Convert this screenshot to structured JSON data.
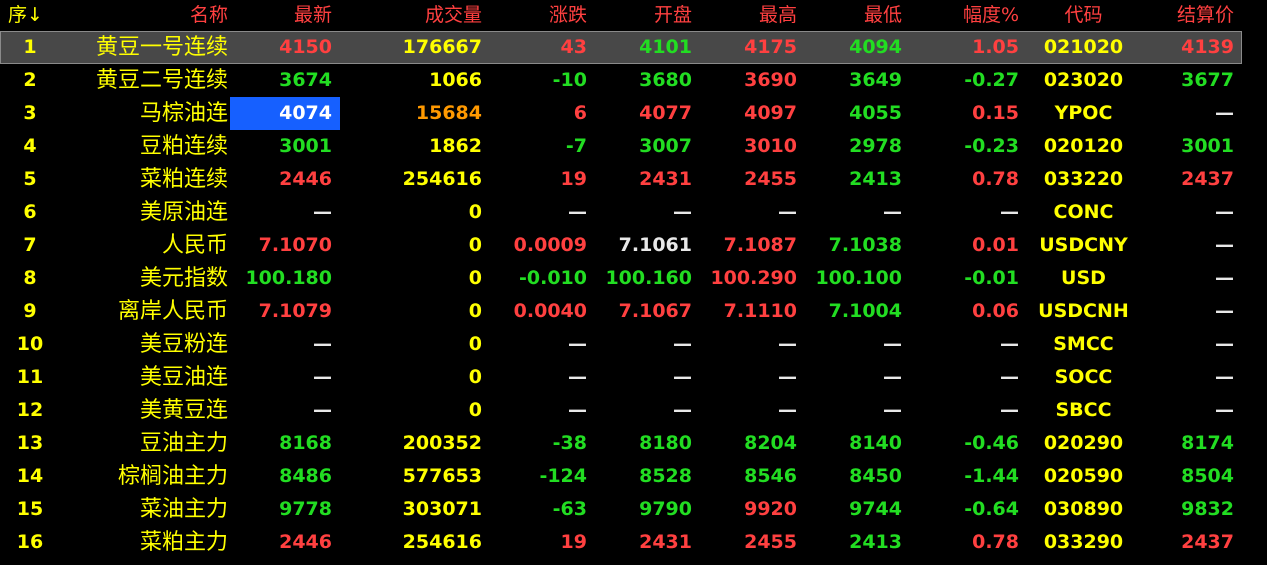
{
  "header": {
    "idx": "序",
    "idx_arrow": "↓",
    "name": "名称",
    "last": "最新",
    "volume": "成交量",
    "change": "涨跌",
    "open": "开盘",
    "high": "最高",
    "low": "最低",
    "pct": "幅度%",
    "code": "代码",
    "settle": "结算价"
  },
  "colors": {
    "up": "#ff4040",
    "down": "#22dd22",
    "header_text": "#ff4040",
    "name_text": "#ffff00",
    "selected_row_bg": "#484848",
    "highlight_cell_bg": "#1660ff"
  },
  "rows": [
    {
      "idx": "1",
      "name": "黄豆一号连续",
      "last": "4150",
      "volume": "176667",
      "change": "43",
      "open": "4101",
      "high": "4175",
      "low": "4094",
      "pct": "1.05",
      "code": "021020",
      "settle": "4139"
    },
    {
      "idx": "2",
      "name": "黄豆二号连续",
      "last": "3674",
      "volume": "1066",
      "change": "-10",
      "open": "3680",
      "high": "3690",
      "low": "3649",
      "pct": "-0.27",
      "code": "023020",
      "settle": "3677"
    },
    {
      "idx": "3",
      "name": "马棕油连",
      "last": "4074",
      "volume": "15684",
      "change": "6",
      "open": "4077",
      "high": "4097",
      "low": "4055",
      "pct": "0.15",
      "code": "YPOC",
      "settle": "—"
    },
    {
      "idx": "4",
      "name": "豆粕连续",
      "last": "3001",
      "volume": "1862",
      "change": "-7",
      "open": "3007",
      "high": "3010",
      "low": "2978",
      "pct": "-0.23",
      "code": "020120",
      "settle": "3001"
    },
    {
      "idx": "5",
      "name": "菜粕连续",
      "last": "2446",
      "volume": "254616",
      "change": "19",
      "open": "2431",
      "high": "2455",
      "low": "2413",
      "pct": "0.78",
      "code": "033220",
      "settle": "2437"
    },
    {
      "idx": "6",
      "name": "美原油连",
      "last": "—",
      "volume": "0",
      "change": "—",
      "open": "—",
      "high": "—",
      "low": "—",
      "pct": "—",
      "code": "CONC",
      "settle": "—"
    },
    {
      "idx": "7",
      "name": "人民币",
      "last": "7.1070",
      "volume": "0",
      "change": "0.0009",
      "open": "7.1061",
      "high": "7.1087",
      "low": "7.1038",
      "pct": "0.01",
      "code": "USDCNY",
      "settle": "—"
    },
    {
      "idx": "8",
      "name": "美元指数",
      "last": "100.180",
      "volume": "0",
      "change": "-0.010",
      "open": "100.160",
      "high": "100.290",
      "low": "100.100",
      "pct": "-0.01",
      "code": "USD",
      "settle": "—"
    },
    {
      "idx": "9",
      "name": "离岸人民币",
      "last": "7.1079",
      "volume": "0",
      "change": "0.0040",
      "open": "7.1067",
      "high": "7.1110",
      "low": "7.1004",
      "pct": "0.06",
      "code": "USDCNH",
      "settle": "—"
    },
    {
      "idx": "10",
      "name": "美豆粉连",
      "last": "—",
      "volume": "0",
      "change": "—",
      "open": "—",
      "high": "—",
      "low": "—",
      "pct": "—",
      "code": "SMCC",
      "settle": "—"
    },
    {
      "idx": "11",
      "name": "美豆油连",
      "last": "—",
      "volume": "0",
      "change": "—",
      "open": "—",
      "high": "—",
      "low": "—",
      "pct": "—",
      "code": "SOCC",
      "settle": "—"
    },
    {
      "idx": "12",
      "name": "美黄豆连",
      "last": "—",
      "volume": "0",
      "change": "—",
      "open": "—",
      "high": "—",
      "low": "—",
      "pct": "—",
      "code": "SBCC",
      "settle": "—"
    },
    {
      "idx": "13",
      "name": "豆油主力",
      "last": "8168",
      "volume": "200352",
      "change": "-38",
      "open": "8180",
      "high": "8204",
      "low": "8140",
      "pct": "-0.46",
      "code": "020290",
      "settle": "8174"
    },
    {
      "idx": "14",
      "name": "棕榈油主力",
      "last": "8486",
      "volume": "577653",
      "change": "-124",
      "open": "8528",
      "high": "8546",
      "low": "8450",
      "pct": "-1.44",
      "code": "020590",
      "settle": "8504"
    },
    {
      "idx": "15",
      "name": "菜油主力",
      "last": "9778",
      "volume": "303071",
      "change": "-63",
      "open": "9790",
      "high": "9920",
      "low": "9744",
      "pct": "-0.64",
      "code": "030890",
      "settle": "9832"
    },
    {
      "idx": "16",
      "name": "菜粕主力",
      "last": "2446",
      "volume": "254616",
      "change": "19",
      "open": "2431",
      "high": "2455",
      "low": "2413",
      "pct": "0.78",
      "code": "033290",
      "settle": "2437"
    }
  ]
}
